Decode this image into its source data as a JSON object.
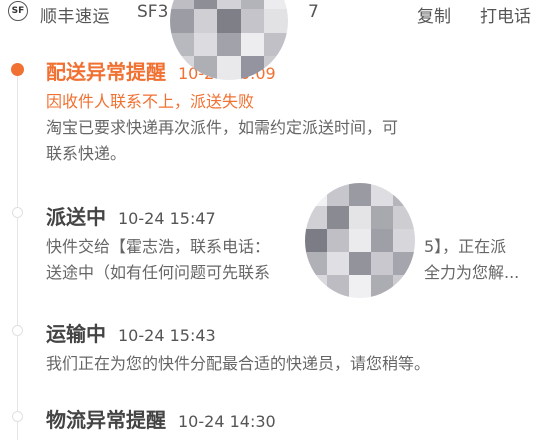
{
  "header": {
    "carrier_name": "顺丰速运",
    "tracking_prefix": "SF3",
    "tracking_suffix": "7",
    "copy_label": "复制",
    "call_label": "打电话"
  },
  "events": [
    {
      "title": "配送异常提醒",
      "time": "10-24 16:09",
      "alert_line": "因收件人联系不上，派送失败",
      "lines": [
        "淘宝已要求快递再次派件，如需约定派送时间，可",
        "联系快递。"
      ]
    },
    {
      "title": "派送中",
      "time": "10-24 15:47",
      "lines_a": [
        "快件交给【霍志浩，联系电话：",
        "送途中（如有任何问题可先联系"
      ],
      "lines_b": [
        "5】，正在派",
        "全力为您解..."
      ]
    },
    {
      "title": "运输中",
      "time": "10-24 15:43",
      "lines": [
        "我们正在为您的快件分配最合适的快递员，请您稍等。"
      ]
    },
    {
      "title": "物流异常提醒",
      "time": "10-24 14:30"
    }
  ],
  "colors": {
    "accent": "#f07132",
    "text": "#555555",
    "muted": "#666666"
  }
}
